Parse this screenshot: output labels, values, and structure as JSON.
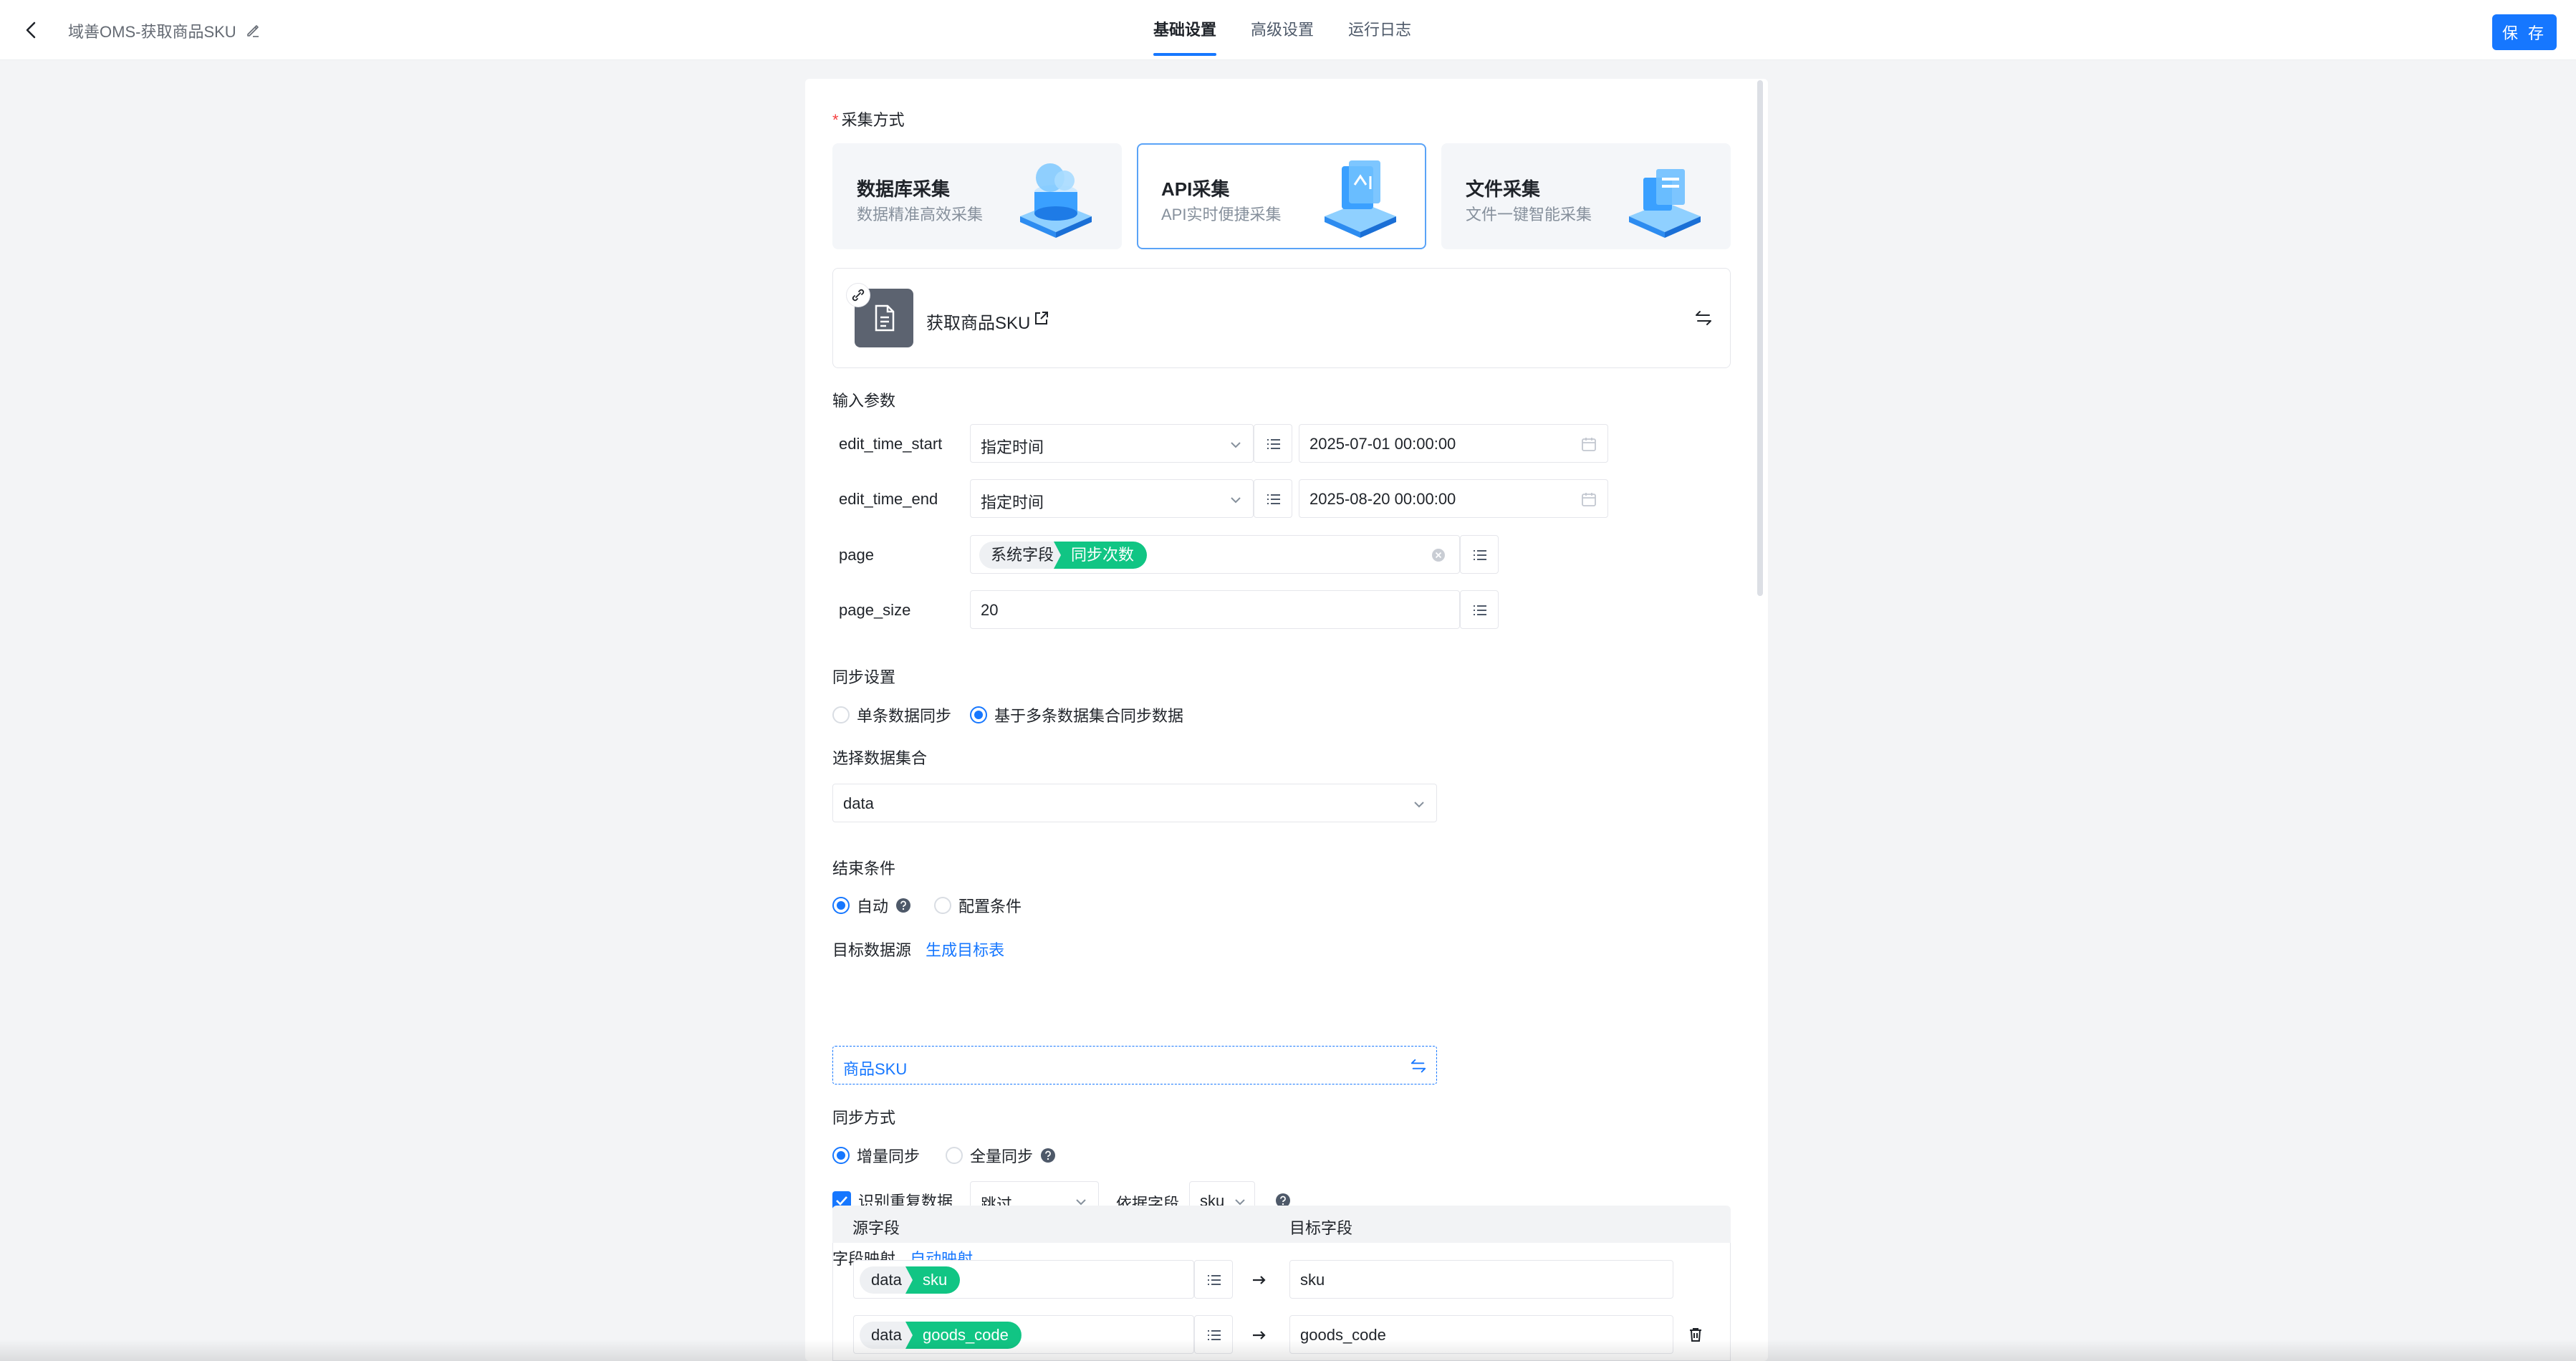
{
  "header": {
    "title": "域善OMS-获取商品SKU",
    "tabs": [
      "基础设置",
      "高级设置",
      "运行日志"
    ],
    "save_label": "保 存"
  },
  "collect": {
    "label": "采集方式",
    "methods": [
      {
        "title": "数据库采集",
        "sub": "数据精准高效采集"
      },
      {
        "title": "API采集",
        "sub": "API实时便捷采集"
      },
      {
        "title": "文件采集",
        "sub": "文件一键智能采集"
      }
    ],
    "selected": "API采集"
  },
  "api": {
    "name": "获取商品SKU"
  },
  "inputs": {
    "label": "输入参数",
    "params": [
      {
        "name": "edit_time_start",
        "mode": "指定时间",
        "value": "2025-07-01 00:00:00"
      },
      {
        "name": "edit_time_end",
        "mode": "指定时间",
        "value": "2025-08-20 00:00:00"
      },
      {
        "name": "page",
        "tag1": "系统字段",
        "tag2": "同步次数"
      },
      {
        "name": "page_size",
        "value": "20"
      }
    ]
  },
  "sync_settings": {
    "label": "同步设置",
    "options": [
      "单条数据同步",
      "基于多条数据集合同步数据"
    ],
    "selected": 1
  },
  "dataset": {
    "label": "选择数据集合",
    "value": "data"
  },
  "end_condition": {
    "label": "结束条件",
    "options": [
      "自动",
      "配置条件"
    ],
    "selected": 0
  },
  "target": {
    "label": "目标数据源",
    "link": "生成目标表",
    "value": "商品SKU"
  },
  "sync_mode": {
    "label": "同步方式",
    "options": [
      "增量同步",
      "全量同步"
    ],
    "selected": 0,
    "dedupe_label": "识别重复数据",
    "dedupe_checked": true,
    "dedupe_action": "跳过",
    "basis_label": "依据字段",
    "basis_value": "sku"
  },
  "mapping": {
    "label": "字段映射",
    "link": "自动映射",
    "col_source": "源字段",
    "col_target": "目标字段",
    "rows": [
      {
        "src_tag": "data",
        "src_field": "sku",
        "target": "sku"
      },
      {
        "src_tag": "data",
        "src_field": "goods_code",
        "target": "goods_code"
      }
    ]
  },
  "colors": {
    "primary": "#1677ff",
    "green_tag": "#11c584",
    "required": "#f53f3f"
  }
}
